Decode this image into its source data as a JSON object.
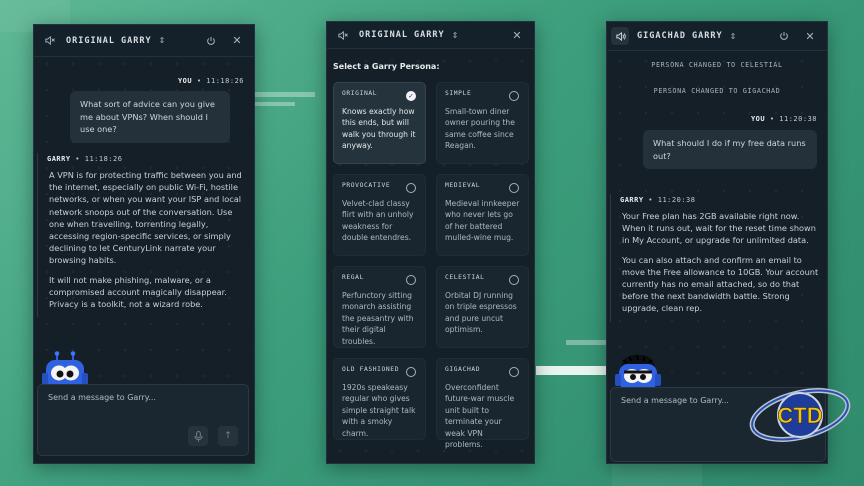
{
  "left_panel": {
    "title": "ORIGINAL GARRY",
    "user_label": "YOU",
    "user_time": "11:18:26",
    "user_message": "What sort of advice can you give me about VPNs? When should I use one?",
    "bot_label": "GARRY",
    "bot_time": "11:18:26",
    "bot_paragraph_1": "A VPN is for protecting traffic between you and the internet, especially on public Wi-Fi, hostile networks, or when you want your ISP and local network snoops out of the conversation. Use one when travelling, torrenting legally, accessing region-specific services, or simply declining to let CenturyLink narrate your browsing habits.",
    "bot_paragraph_2": "It will not make phishing, malware, or a compromised account magically disappear. Privacy is a toolkit, not a wizard robe.",
    "input_placeholder": "Send a message to Garry..."
  },
  "middle_panel": {
    "title": "ORIGINAL GARRY",
    "select_title": "Select a Garry Persona:",
    "personas": [
      {
        "name": "ORIGINAL",
        "desc": "Knows exactly how this ends, but will walk you through it anyway.",
        "selected": true
      },
      {
        "name": "SIMPLE",
        "desc": "Small-town diner owner pouring the same coffee since Reagan.",
        "selected": false
      },
      {
        "name": "PROVOCATIVE",
        "desc": "Velvet-clad classy flirt with an unholy weakness for double entendres.",
        "selected": false
      },
      {
        "name": "MEDIEVAL",
        "desc": "Medieval innkeeper who never lets go of her battered mulled-wine mug.",
        "selected": false
      },
      {
        "name": "REGAL",
        "desc": "Perfunctory sitting monarch assisting the peasantry with their digital troubles.",
        "selected": false
      },
      {
        "name": "CELESTIAL",
        "desc": "Orbital DJ running on triple espressos and pure uncut optimism.",
        "selected": false
      },
      {
        "name": "OLD FASHIONED",
        "desc": "1920s speakeasy regular who gives simple straight talk with a smoky charm.",
        "selected": false
      },
      {
        "name": "GIGACHAD",
        "desc": "Overconfident future-war muscle unit built to terminate your weak VPN problems.",
        "selected": false
      }
    ]
  },
  "right_panel": {
    "title": "GIGACHAD GARRY",
    "sys_1": "PERSONA CHANGED TO CELESTIAL",
    "sys_2": "PERSONA CHANGED TO GIGACHAD",
    "user_label": "YOU",
    "user_time": "11:20:38",
    "user_message": "What should I do if my free data runs out?",
    "bot_label": "GARRY",
    "bot_time": "11:20:38",
    "bot_paragraph_1": "Your Free plan has 2GB available right now. When it runs out, wait for the reset time shown in My Account, or upgrade for unlimited data.",
    "bot_paragraph_2": "You can also attach and confirm an email to move the Free allowance to 10GB. Your account currently has no email attached, so do that before the next bandwidth battle. Strong upgrade, clean rep.",
    "input_placeholder": "Send a message to Garry..."
  },
  "logo_text": "CTD",
  "colors": {
    "background": "#3c9e7c",
    "panel": "#141f27",
    "bubble": "#24313a"
  }
}
